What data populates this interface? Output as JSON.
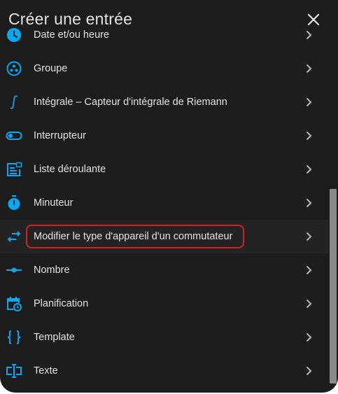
{
  "dialog": {
    "title": "Créer une entrée"
  },
  "items": [
    {
      "label": "Date et/ou heure",
      "icon": "clock-icon"
    },
    {
      "label": "Groupe",
      "icon": "group-icon"
    },
    {
      "label": "Intégrale – Capteur d'intégrale de Riemann",
      "icon": "integral-icon"
    },
    {
      "label": "Interrupteur",
      "icon": "toggle-switch-icon"
    },
    {
      "label": "Liste déroulante",
      "icon": "form-dropdown-icon"
    },
    {
      "label": "Minuteur",
      "icon": "timer-icon"
    },
    {
      "label": "Modifier le type d'appareil d'un commutateur",
      "icon": "swap-arrows-icon",
      "highlighted": true
    },
    {
      "label": "Nombre",
      "icon": "ray-vertex-icon"
    },
    {
      "label": "Planification",
      "icon": "calendar-clock-icon"
    },
    {
      "label": "Template",
      "icon": "code-braces-icon"
    },
    {
      "label": "Texte",
      "icon": "form-textbox-icon"
    }
  ],
  "colors": {
    "accent": "#03a9f4",
    "highlight_border": "#d0222a",
    "background": "#1c1c1c",
    "text": "#e4e4e4"
  }
}
